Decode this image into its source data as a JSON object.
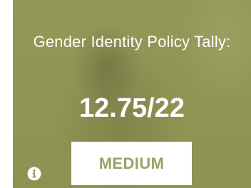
{
  "card": {
    "title": "Gender Identity Policy Tally:",
    "score": "12.75/22",
    "rating": "MEDIUM",
    "info_icon": "info-icon"
  },
  "colors": {
    "tint": "#8f9554",
    "rating_text": "#9ba262",
    "badge_bg": "#ffffff",
    "text": "#ffffff"
  }
}
